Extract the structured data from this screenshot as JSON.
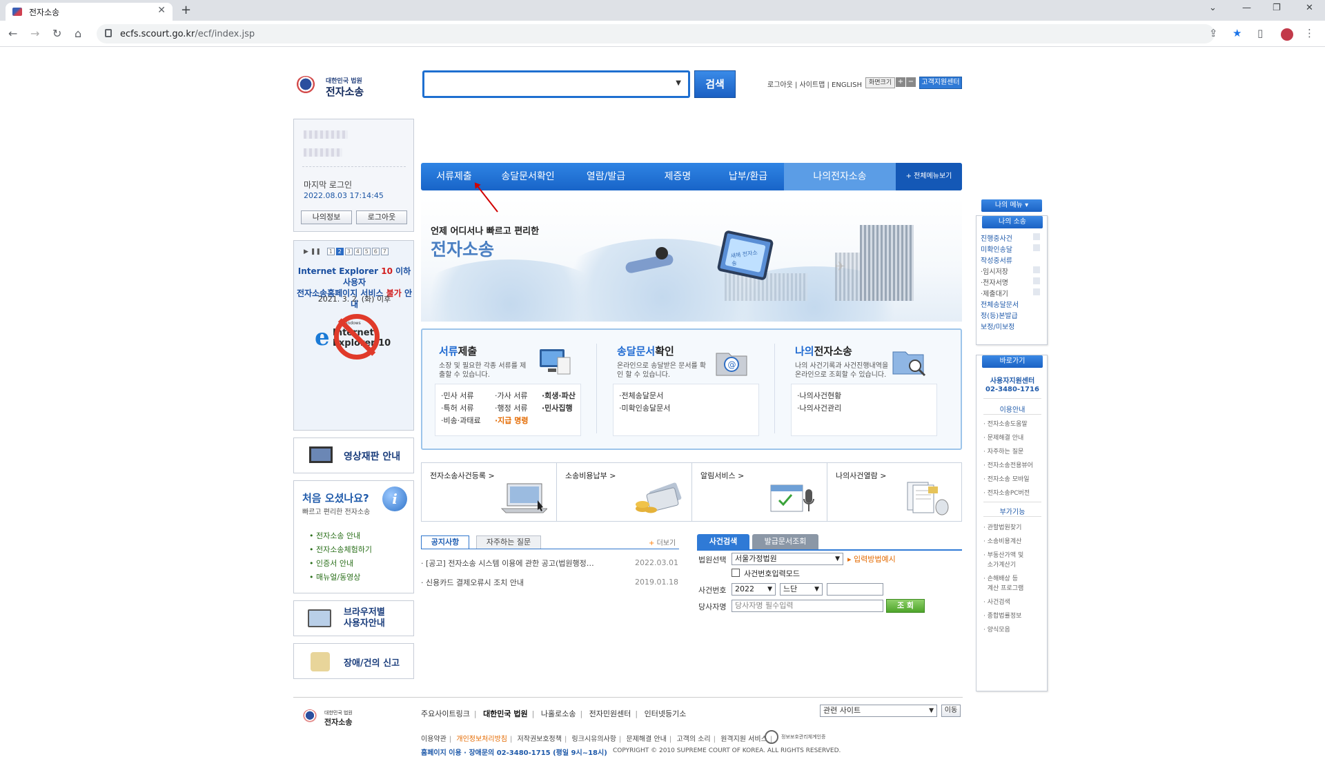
{
  "browser": {
    "tab_title": "전자소송",
    "tab_close": "✕",
    "new_tab": "+",
    "url_host": "ecfs.scourt.go.kr",
    "url_path": "/ecf/index.jsp"
  },
  "header": {
    "logo_small": "대한민국 법원",
    "logo_big": "전자소송",
    "search_placeholder": "",
    "search_button": "검색",
    "toplinks": "로그아웃 | 사이트맵 | ENGLISH",
    "font_size_label": "화면크기",
    "font_plus": "+",
    "font_minus": "−",
    "support_button": "고객지원센터"
  },
  "nav": {
    "items": [
      "서류제출",
      "송달문서확인",
      "열람/발급",
      "제증명",
      "납부/환급",
      "나의전자소송"
    ],
    "all_menu": "+ 전체메뉴보기"
  },
  "login": {
    "last_login_label": "마지막 로그인",
    "last_login_time": "2022.08.03 17:14:45",
    "my_info": "나의정보",
    "logout": "로그아웃"
  },
  "ie_banner": {
    "pages": [
      "1",
      "2",
      "3",
      "4",
      "5",
      "6",
      "7"
    ],
    "line1_a": "Internet Explorer ",
    "line1_b": "10",
    "line1_c": " 이하 사용자",
    "line2_a": "전자소송홈페이지 서비스 ",
    "line2_b": "불가",
    "line2_c": " 안내",
    "date": "2021. 3. 2. (화) 이후",
    "logo_word": "Internet Explorer 10",
    "logo_windows": "Windows"
  },
  "left_boxes": {
    "video": "영상재판 안내",
    "first_title": "처음 오셨나요?",
    "first_sub": "빠르고 편리한 전자소송",
    "first_links": [
      "전자소송 안내",
      "전자소송체험하기",
      "인증서 안내",
      "매뉴얼/동영상"
    ],
    "browser_line1": "브라우저별",
    "browser_line2": "사용자안내",
    "error": "장애/건의 신고"
  },
  "hero": {
    "line1": "언제 어디서나 빠르고 편리한",
    "line2": "전자소송",
    "monitor_text": "새해 전자소송"
  },
  "services": [
    {
      "title_hl": "서류",
      "title_rest": "제출",
      "desc": "소장 및 필요한 각종 서류를 제출할 수 있습니다.",
      "links": [
        "·민사 서류",
        "·가사 서류",
        "·회생·파산",
        "·특허 서류",
        "·행정 서류",
        "·민사집행",
        "·비송·과태료",
        "·지급 명령"
      ]
    },
    {
      "title_hl": "송달문서",
      "title_rest": "확인",
      "desc": "온라인으로 송달받은 문서를 확인 할 수 있습니다.",
      "links": [
        "·전체송달문서",
        "·미확인송달문서"
      ]
    },
    {
      "title_hl": "나의",
      "title_rest": "전자소송",
      "desc": "나의 사건기록과 사건진행내역을 온라인으로 조회할 수 있습니다.",
      "links": [
        "·나의사건현황",
        "·나의사건관리"
      ]
    }
  ],
  "tiles": [
    "전자소송사건등록 >",
    "소송비용납부 >",
    "알림서비스 >",
    "나의사건열람 >"
  ],
  "notice": {
    "tab_notice": "공지사항",
    "tab_faq": "자주하는 질문",
    "more": "더보기",
    "more_plus": "+",
    "items": [
      {
        "title": "· [공고] 전자소송 시스템 이용에 관한 공고(법원행정…",
        "date": "2022.03.01"
      },
      {
        "title": "· 신용카드 결제오류시 조치 안내",
        "date": "2019.01.18"
      }
    ]
  },
  "case_search": {
    "tab_case": "사건검색",
    "tab_doc": "발급문서조회",
    "court_label": "법원선택",
    "court_value": "서울가정법원",
    "hint": "▸ 입력방법예시",
    "checkbox_label": "사건번호입력모드",
    "case_no_label": "사건번호",
    "year_value": "2022",
    "type_value": "느단",
    "party_label": "당사자명",
    "party_placeholder": "당사자명 필수입력",
    "search_button": "조 회"
  },
  "right_sidebar": {
    "my_menu": "나의 메뉴 ▾",
    "my_case": "나의 소송",
    "case_items": [
      "진행중사건",
      "미확인송달",
      "작성중서류",
      "·임시저장",
      "·전자서명",
      "·제출대기",
      "전체송달문서",
      "정(등)본발급",
      "보정/미보정"
    ],
    "shortcut": "바로가기",
    "support_center": "사용자지원센터",
    "support_phone": "02-3480-1716",
    "guide_title": "이용안내",
    "guide_items": [
      "· 전자소송도움말",
      "· 문제해결 안내",
      "· 자주하는 질문",
      "· 전자소송전용뷰어",
      "· 전자소송 모바일",
      "· 전자소송PC버전"
    ],
    "extra_title": "부가기능",
    "extra_items": [
      "· 관할법원찾기",
      "· 소송비용계산",
      "· 부동산가액 및",
      "  소가계산기",
      "· 손해배상 등",
      "  계산 프로그램",
      "· 사건검색",
      "· 종합법률정보",
      "· 양식모음"
    ]
  },
  "footer": {
    "logo_small": "대한민국 법원",
    "logo_big": "전자소송",
    "links": [
      "주요사이트링크",
      "대한민국 법원",
      "나홀로소송",
      "전자민원센터",
      "인터넷등기소"
    ],
    "related_select": "관련 사이트",
    "go": "이동",
    "links2": [
      "이용약관",
      "개인정보처리방침",
      "저작권보호정책",
      "링크시유의사항",
      "문제해결 안내",
      "고객의 소리",
      "원격지원 서비스"
    ],
    "seal_text": "정보보호관리체계인증",
    "phone": "홈페이지 이용 · 장애문의 02-3480-1715 (평일 9시~18시)",
    "copyright": "COPYRIGHT © 2010 SUPREME COURT OF KOREA. ALL RIGHTS RESERVED."
  }
}
